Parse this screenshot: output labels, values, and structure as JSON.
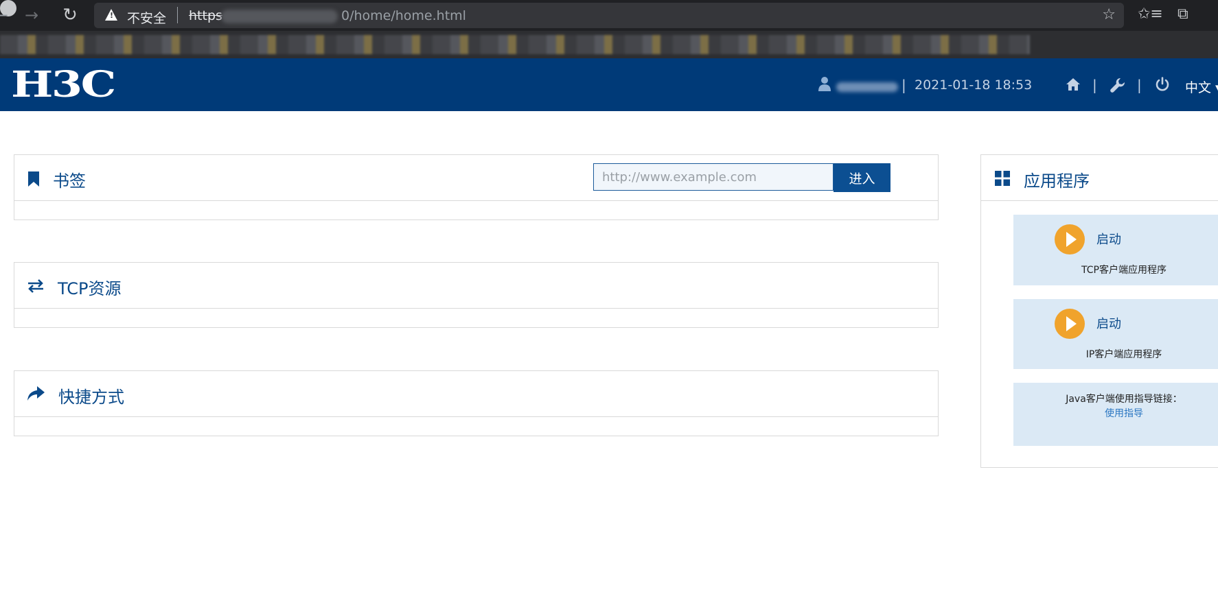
{
  "browser": {
    "security_label": "不安全",
    "url_protocol": "https",
    "url_path": "0/home/home.html"
  },
  "header": {
    "logo_text": "H3C",
    "separator": "|",
    "datetime": "2021-01-18 18:53",
    "language": "中文 ▾"
  },
  "bookmarks_panel": {
    "title": "书签",
    "url_placeholder": "http://www.example.com",
    "enter_label": "进入"
  },
  "tcp_panel": {
    "title": "TCP资源"
  },
  "shortcuts_panel": {
    "title": "快捷方式"
  },
  "apps_panel": {
    "title": "应用程序",
    "apps": [
      {
        "launch_label": "启动",
        "name": "TCP客户端应用程序"
      },
      {
        "launch_label": "启动",
        "name": "IP客户端应用程序"
      }
    ],
    "java_guide_text": "Java客户端使用指导链接：",
    "java_guide_link": "使用指导"
  },
  "colors": {
    "header_bg": "#003a78",
    "accent_blue": "#0c4f92",
    "launch_orange": "#f0a32c",
    "card_bg": "#dbe9f5"
  },
  "icons": [
    "back-icon",
    "forward-icon",
    "reload-icon",
    "warning-icon",
    "star-icon",
    "favorites-icon",
    "collections-icon",
    "user-icon",
    "home-icon",
    "wrench-icon",
    "power-icon",
    "bookmark-icon",
    "swap-arrows-icon",
    "share-arrow-icon",
    "grid-icon",
    "play-icon"
  ]
}
